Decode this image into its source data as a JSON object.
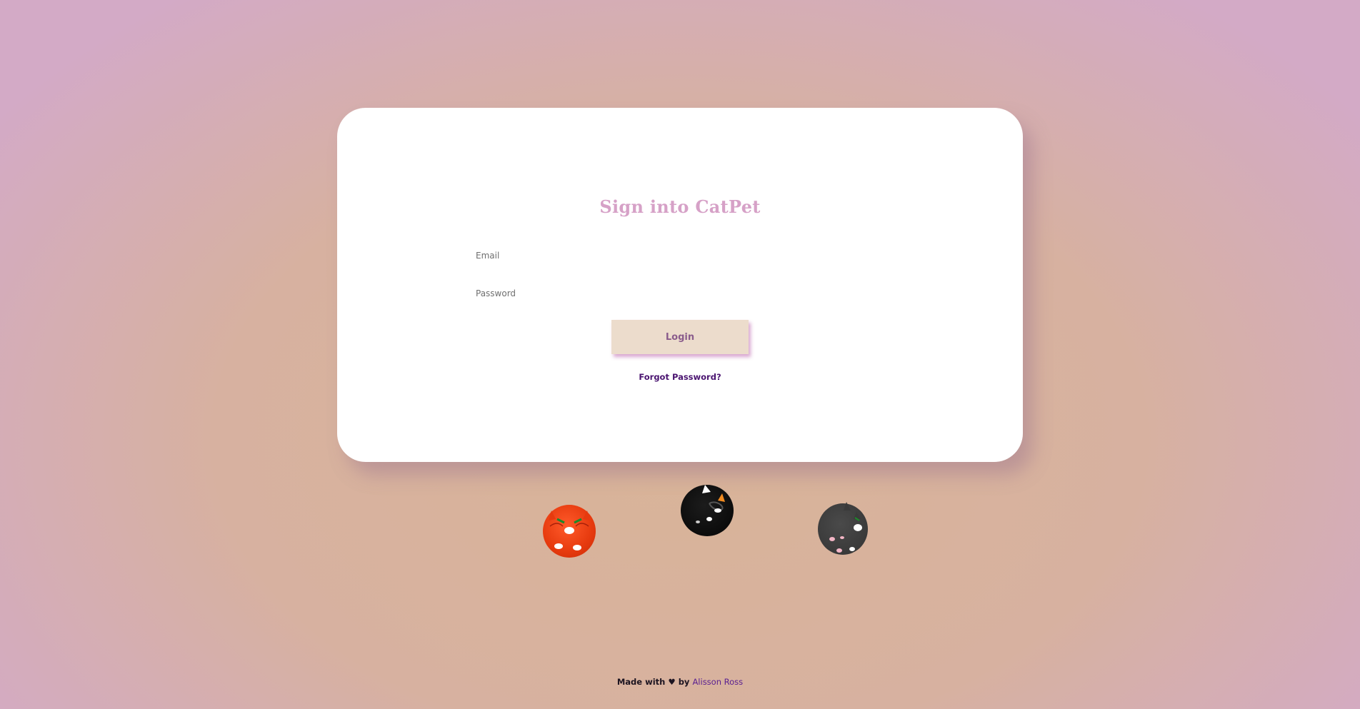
{
  "login_card": {
    "title": "Sign into CatPet",
    "email_placeholder": "Email",
    "password_placeholder": "Password",
    "login_label": "Login",
    "forgot_password_label": "Forgot Password?"
  },
  "cats": [
    {
      "name": "orange-cat",
      "color": "#e63a0e"
    },
    {
      "name": "black-cat",
      "color": "#050505"
    },
    {
      "name": "gray-cat",
      "color": "#3a3a3a"
    }
  ],
  "footer": {
    "made_with": "Made with",
    "heart": "♥",
    "by": "by",
    "author": "Alisson Ross"
  },
  "colors": {
    "title": "#d6a1c7",
    "button_bg": "#ecdccc",
    "button_text": "#8a5c8c",
    "link": "#4a1470",
    "author_link": "#5a2090"
  }
}
